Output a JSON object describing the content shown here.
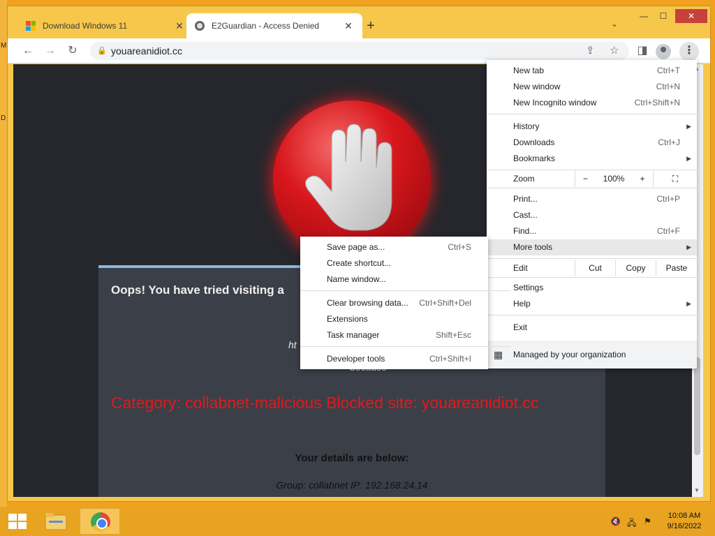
{
  "desktop": {
    "glyph_top": "M",
    "glyph_mid": "D"
  },
  "browser": {
    "tabs": [
      {
        "title": "Download Windows 11",
        "active": false
      },
      {
        "title": "E2Guardian - Access Denied",
        "active": true
      }
    ],
    "new_tab_symbol": "+",
    "tab_close_symbol": "✕",
    "tab_search_symbol": "⌄",
    "window_controls": {
      "minimize": "—",
      "maximize": "☐",
      "close": "✕"
    },
    "nav": {
      "back": "←",
      "forward": "→",
      "reload": "↻"
    },
    "address": {
      "url": "youareanidiot.cc",
      "lock_icon": "lock-icon"
    },
    "omnibox_actions": {
      "share": "⇪",
      "bookmark": "☆"
    },
    "side_panel_symbol": "◨",
    "menu_symbol": "⋮"
  },
  "page": {
    "heading": "Oops! You have tried visiting a",
    "fragment_url": "ht",
    "fragment_because": "because",
    "category_line": "Category: collabnet-malicious  Blocked site: youareanidiot.cc",
    "details_heading": "Your details are below:",
    "details_line": "Group: collabnet    IP: 192.168.24.14"
  },
  "main_menu": {
    "items": [
      {
        "label": "New tab",
        "shortcut": "Ctrl+T"
      },
      {
        "label": "New window",
        "shortcut": "Ctrl+N"
      },
      {
        "label": "New Incognito window",
        "shortcut": "Ctrl+Shift+N"
      },
      {
        "label": "History",
        "shortcut": "",
        "submenu": true
      },
      {
        "label": "Downloads",
        "shortcut": "Ctrl+J"
      },
      {
        "label": "Bookmarks",
        "shortcut": "",
        "submenu": true
      },
      {
        "label": "Print...",
        "shortcut": "Ctrl+P"
      },
      {
        "label": "Cast...",
        "shortcut": ""
      },
      {
        "label": "Find...",
        "shortcut": "Ctrl+F"
      },
      {
        "label": "More tools",
        "shortcut": "",
        "submenu": true,
        "highlighted": true
      },
      {
        "label": "Settings",
        "shortcut": ""
      },
      {
        "label": "Help",
        "shortcut": "",
        "submenu": true
      },
      {
        "label": "Exit",
        "shortcut": ""
      }
    ],
    "zoom": {
      "label": "Zoom",
      "minus": "−",
      "value": "100%",
      "plus": "+",
      "fullscreen": "⛶"
    },
    "edit": {
      "label": "Edit",
      "cut": "Cut",
      "copy": "Copy",
      "paste": "Paste"
    },
    "managed": {
      "label": "Managed by your organization",
      "icon": "building-icon"
    },
    "submenu_arrow": "▶"
  },
  "more_tools_menu": {
    "items": [
      {
        "label": "Save page as...",
        "shortcut": "Ctrl+S"
      },
      {
        "label": "Create shortcut...",
        "shortcut": ""
      },
      {
        "label": "Name window...",
        "shortcut": ""
      },
      {
        "label": "Clear browsing data...",
        "shortcut": "Ctrl+Shift+Del"
      },
      {
        "label": "Extensions",
        "shortcut": ""
      },
      {
        "label": "Task manager",
        "shortcut": "Shift+Esc"
      },
      {
        "label": "Developer tools",
        "shortcut": "Ctrl+Shift+I"
      }
    ]
  },
  "taskbar": {
    "tray": {
      "volume": "🔇",
      "network": "🖧",
      "flag": "⚑"
    },
    "clock": {
      "time": "10:08 AM",
      "date": "9/16/2022"
    }
  },
  "colors": {
    "desktop": "#f0a11e",
    "window_frame": "#f6c74a",
    "page_bg": "#25272d",
    "card_bg": "#3b3f48",
    "category_red": "#e3191c",
    "taskbar": "#e8a421"
  }
}
